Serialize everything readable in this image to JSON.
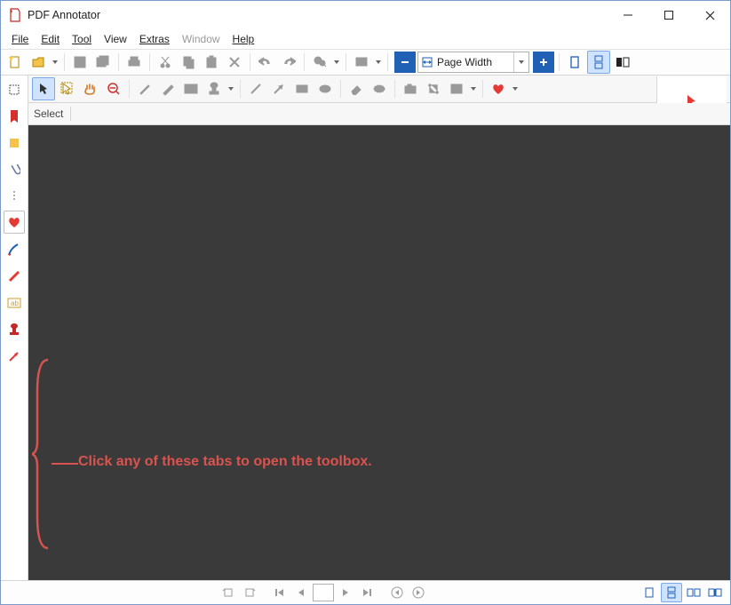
{
  "titlebar": {
    "title": "PDF Annotator"
  },
  "menu": {
    "file": "File",
    "edit": "Edit",
    "tool": "Tool",
    "view": "View",
    "extras": "Extras",
    "window": "Window",
    "help": "Help"
  },
  "toolbar_top": {
    "zoom_value": "Page Width"
  },
  "subbar": {
    "mode_label": "Select"
  },
  "hint": {
    "text": "Click any of these tabs to open the toolbox."
  }
}
